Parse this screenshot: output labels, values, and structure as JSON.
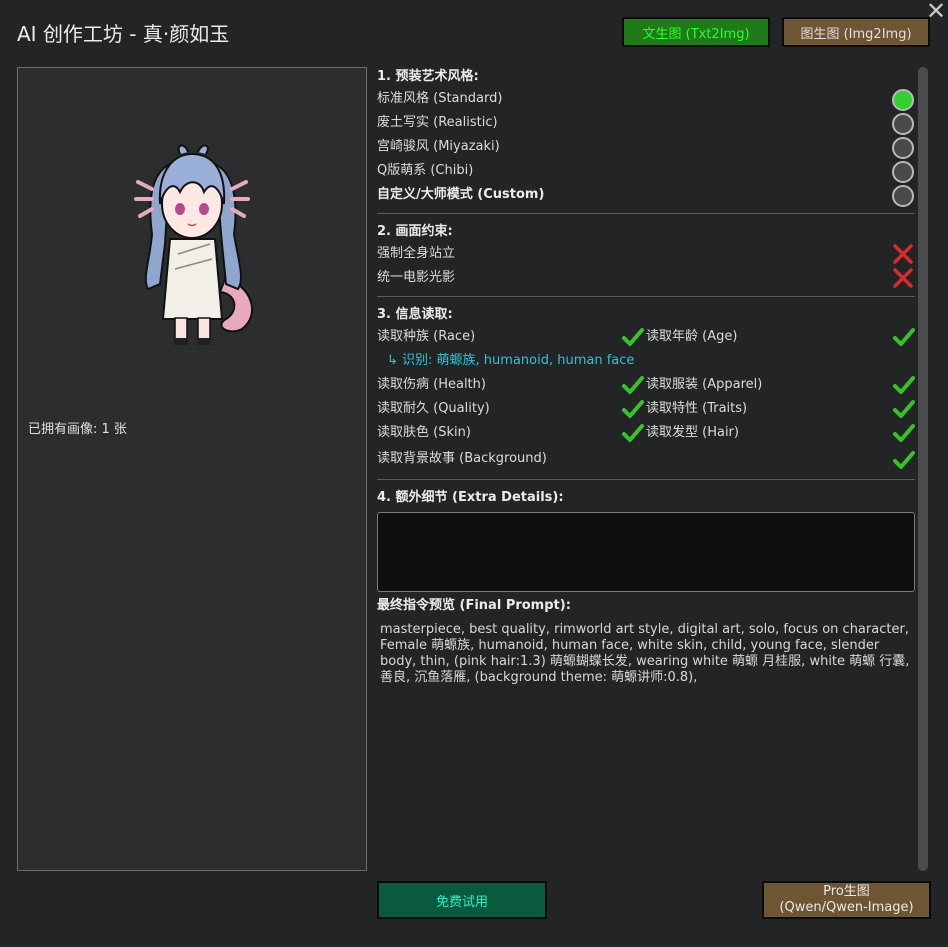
{
  "window": {
    "title": "AI 创作工坊 - 真·颜如玉"
  },
  "toolbar": {
    "txt2img_label": "文生图 (Txt2Img)",
    "img2img_label": "图生图 (Img2Img)"
  },
  "portrait": {
    "owned_label": "已拥有画像: 1 张"
  },
  "styles": {
    "header": "1. 预装艺术风格:",
    "options": [
      {
        "label": "标准风格 (Standard)",
        "selected": true
      },
      {
        "label": "废土写实 (Realistic)",
        "selected": false
      },
      {
        "label": "宫崎骏风 (Miyazaki)",
        "selected": false
      },
      {
        "label": "Q版萌系 (Chibi)",
        "selected": false
      },
      {
        "label": "自定义/大师模式 (Custom)",
        "selected": false
      }
    ]
  },
  "constraints": {
    "header": "2. 画面约束:",
    "items": [
      {
        "label": "强制全身站立",
        "enabled": false
      },
      {
        "label": "统一电影光影",
        "enabled": false
      }
    ]
  },
  "info": {
    "header": "3. 信息读取:",
    "race": "读取种族 (Race)",
    "age": "读取年龄 (Age)",
    "identified": "↳ 识别: 萌螈族, humanoid, human face",
    "health": "读取伤病 (Health)",
    "apparel": "读取服装 (Apparel)",
    "quality": "读取耐久 (Quality)",
    "traits": "读取特性 (Traits)",
    "skin": "读取肤色 (Skin)",
    "hair": "读取发型 (Hair)",
    "background": "读取背景故事 (Background)"
  },
  "extra": {
    "header": "4. 额外细节 (Extra Details):",
    "value": ""
  },
  "final_prompt": {
    "header": "最终指令预览 (Final Prompt):",
    "text": "masterpiece, best quality, rimworld art style, digital art, solo, focus on character, Female 萌螈族, humanoid, human face, white skin, child, young face, slender body, thin, (pink hair:1.3) 萌螈蝴蝶长发, wearing white 萌螈 月桂服, white 萌螈 行囊, 善良, 沉鱼落雁, (background theme: 萌螈讲师:0.8),"
  },
  "actions": {
    "free_label": "免费试用",
    "pro_line1": "Pro生图",
    "pro_line2": "(Qwen/Qwen-Image)"
  },
  "colors": {
    "accent_green": "#2ed12e",
    "cross_red": "#d62c2c",
    "ident_cyan": "#2ec4d6"
  }
}
